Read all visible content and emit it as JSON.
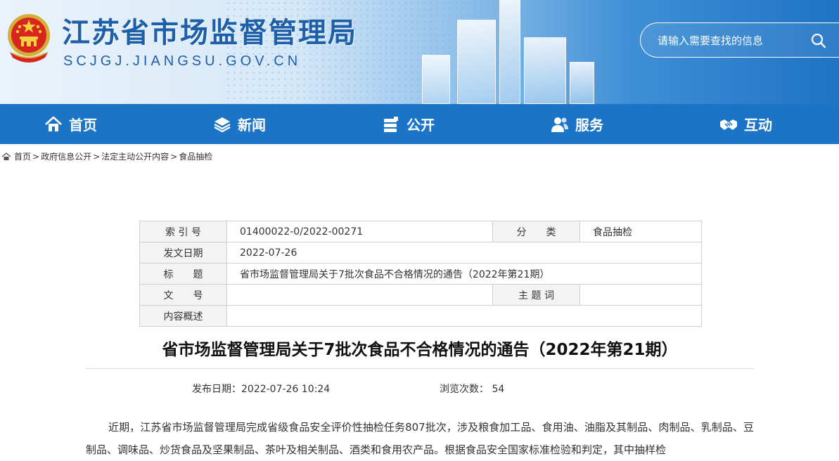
{
  "header": {
    "title": "江苏省市场监督管理局",
    "url": "SCJGJ.JIANGSU.GOV.CN",
    "search_placeholder": "请输入需要查找的信息"
  },
  "nav": [
    {
      "label": "首页",
      "icon": "home-icon"
    },
    {
      "label": "新闻",
      "icon": "layers-icon"
    },
    {
      "label": "公开",
      "icon": "documents-icon"
    },
    {
      "label": "服务",
      "icon": "users-icon"
    },
    {
      "label": "互动",
      "icon": "handshake-icon"
    }
  ],
  "breadcrumb": {
    "items": [
      "首页",
      "政府信息公开",
      "法定主动公开内容",
      "食品抽检"
    ],
    "separator": ">"
  },
  "info_table": {
    "index_label": "索 引 号",
    "index_value": "01400022-0/2022-00271",
    "category_label": "分　　类",
    "category_value": "食品抽检",
    "date_label": "发文日期",
    "date_value": "2022-07-26",
    "title_label": "标　　题",
    "title_value": "省市场监督管理局关于7批次食品不合格情况的通告（2022年第21期）",
    "doc_no_label": "文　　号",
    "doc_no_value": "",
    "keyword_label": "主 题 词",
    "keyword_value": "",
    "summary_label": "内容概述",
    "summary_value": ""
  },
  "article": {
    "title": "省市场监督管理局关于7批次食品不合格情况的通告（2022年第21期）",
    "publish_date": "发布日期：2022-07-26 10:24",
    "views": "浏览次数： 54",
    "body": "近期，江苏省市场监督管理局完成省级食品安全评价性抽检任务807批次，涉及粮食加工品、食用油、油脂及其制品、肉制品、乳制品、豆制品、调味品、炒货食品及坚果制品、茶叶及相关制品、酒类和食用农产品。根据食品安全国家标准检验和判定，其中抽样检"
  },
  "colors": {
    "nav_bg": "#1b74c5",
    "title_blue": "#1d5fa8",
    "table_label_bg": "#f3f3f3"
  }
}
